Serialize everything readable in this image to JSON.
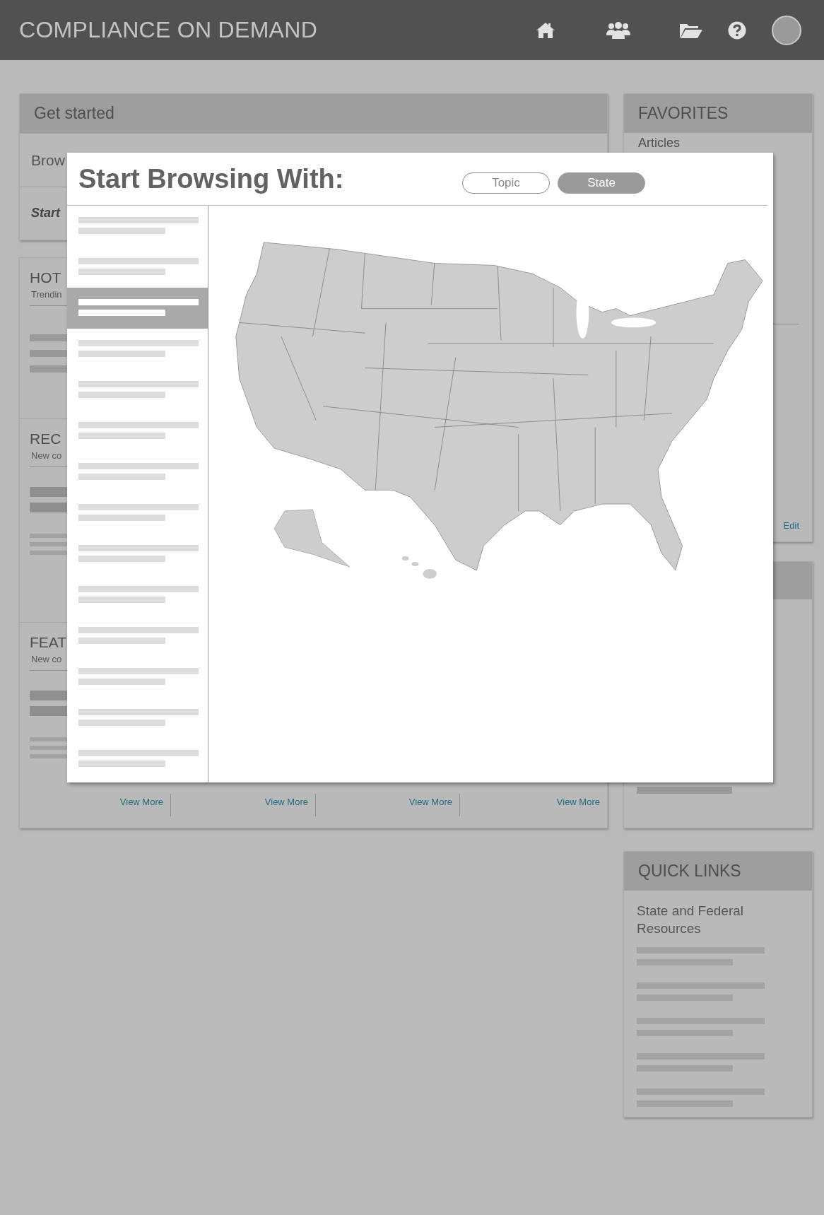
{
  "header": {
    "title": "COMPLIANCE ON DEMAND"
  },
  "get_started": {
    "title": "Get started",
    "browse_label": "Brow",
    "start_label": "Start"
  },
  "feed_sections": [
    {
      "title": "HOT",
      "subtitle": "Trendin",
      "kind": "trending"
    },
    {
      "title": "REC",
      "subtitle": "New co",
      "kind": "featured"
    },
    {
      "title": "FEAT",
      "subtitle": "New co",
      "kind": "featured"
    }
  ],
  "view_more_links": [
    "View More",
    "View More",
    "View More",
    "View More"
  ],
  "favorites": {
    "title": "FAVORITES",
    "items": [
      "Articles"
    ],
    "edit_link": "Edit"
  },
  "quick_links": {
    "title": "QUICK LINKS",
    "subtitle": "State and Federal Resources"
  },
  "browse_dialog": {
    "title": "Start Browsing With:",
    "modes": [
      {
        "label": "Topic",
        "selected": false
      },
      {
        "label": "State",
        "selected": true
      }
    ],
    "list_items": [
      {
        "selected": false
      },
      {
        "selected": false
      },
      {
        "selected": true
      },
      {
        "selected": false
      },
      {
        "selected": false
      },
      {
        "selected": false
      },
      {
        "selected": false
      },
      {
        "selected": false
      },
      {
        "selected": false
      },
      {
        "selected": false
      },
      {
        "selected": false
      },
      {
        "selected": false
      },
      {
        "selected": false
      },
      {
        "selected": false
      }
    ]
  }
}
